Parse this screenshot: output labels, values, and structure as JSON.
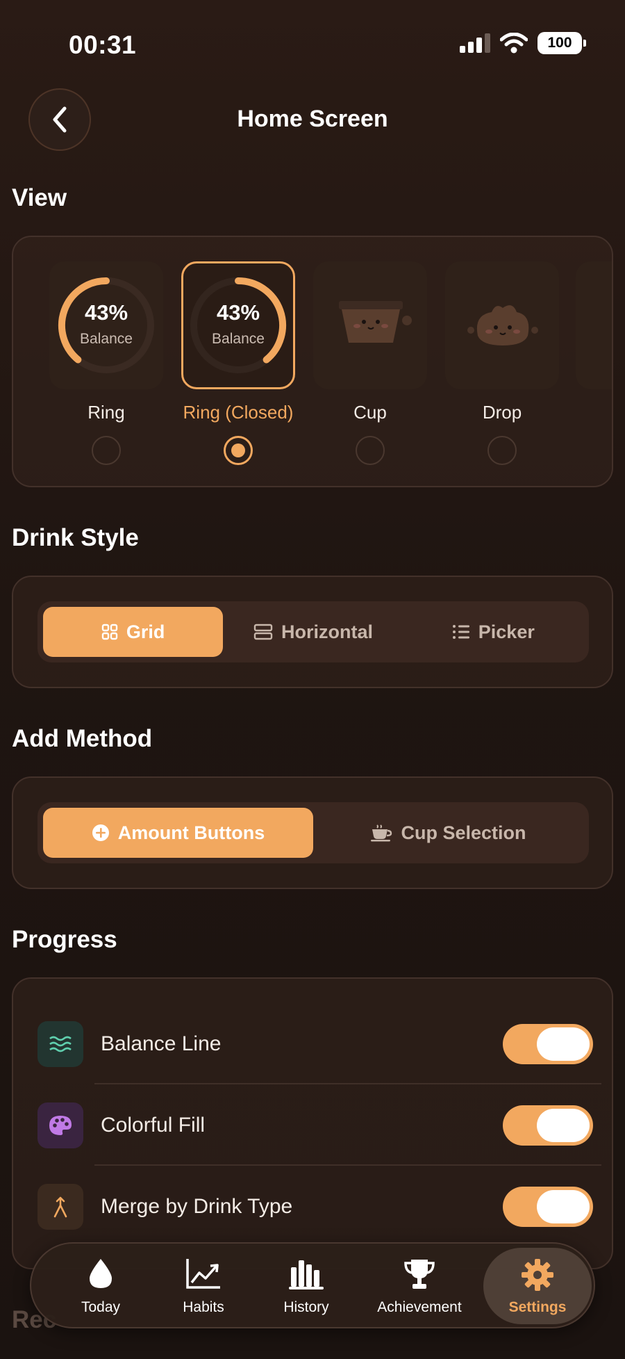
{
  "status_bar": {
    "time": "00:31",
    "battery": "100"
  },
  "header": {
    "title": "Home Screen"
  },
  "view": {
    "title": "View",
    "items": [
      {
        "label": "Ring",
        "percent": "43%",
        "sub": "Balance",
        "selected": false
      },
      {
        "label": "Ring (Closed)",
        "percent": "43%",
        "sub": "Balance",
        "selected": true
      },
      {
        "label": "Cup",
        "selected": false
      },
      {
        "label": "Drop",
        "selected": false
      }
    ]
  },
  "drink_style": {
    "title": "Drink Style",
    "options": [
      "Grid",
      "Horizontal",
      "Picker"
    ],
    "selected": "Grid"
  },
  "add_method": {
    "title": "Add Method",
    "options": [
      "Amount Buttons",
      "Cup Selection"
    ],
    "selected": "Amount Buttons"
  },
  "progress": {
    "title": "Progress",
    "rows": [
      {
        "label": "Balance Line",
        "enabled": true,
        "icon": "waves-icon"
      },
      {
        "label": "Colorful Fill",
        "enabled": true,
        "icon": "palette-icon"
      },
      {
        "label": "Merge by Drink Type",
        "enabled": true,
        "icon": "merge-icon"
      }
    ]
  },
  "next_section_title": "Rec",
  "tabbar": {
    "tabs": [
      {
        "label": "Today",
        "icon": "drop-icon"
      },
      {
        "label": "Habits",
        "icon": "chart-up-icon"
      },
      {
        "label": "History",
        "icon": "bars-icon"
      },
      {
        "label": "Achievement",
        "icon": "trophy-icon"
      },
      {
        "label": "Settings",
        "icon": "gear-icon"
      }
    ],
    "active": "Settings"
  },
  "colors": {
    "accent": "#f2a85f",
    "background": "#1f1511",
    "card": "#34251e"
  }
}
